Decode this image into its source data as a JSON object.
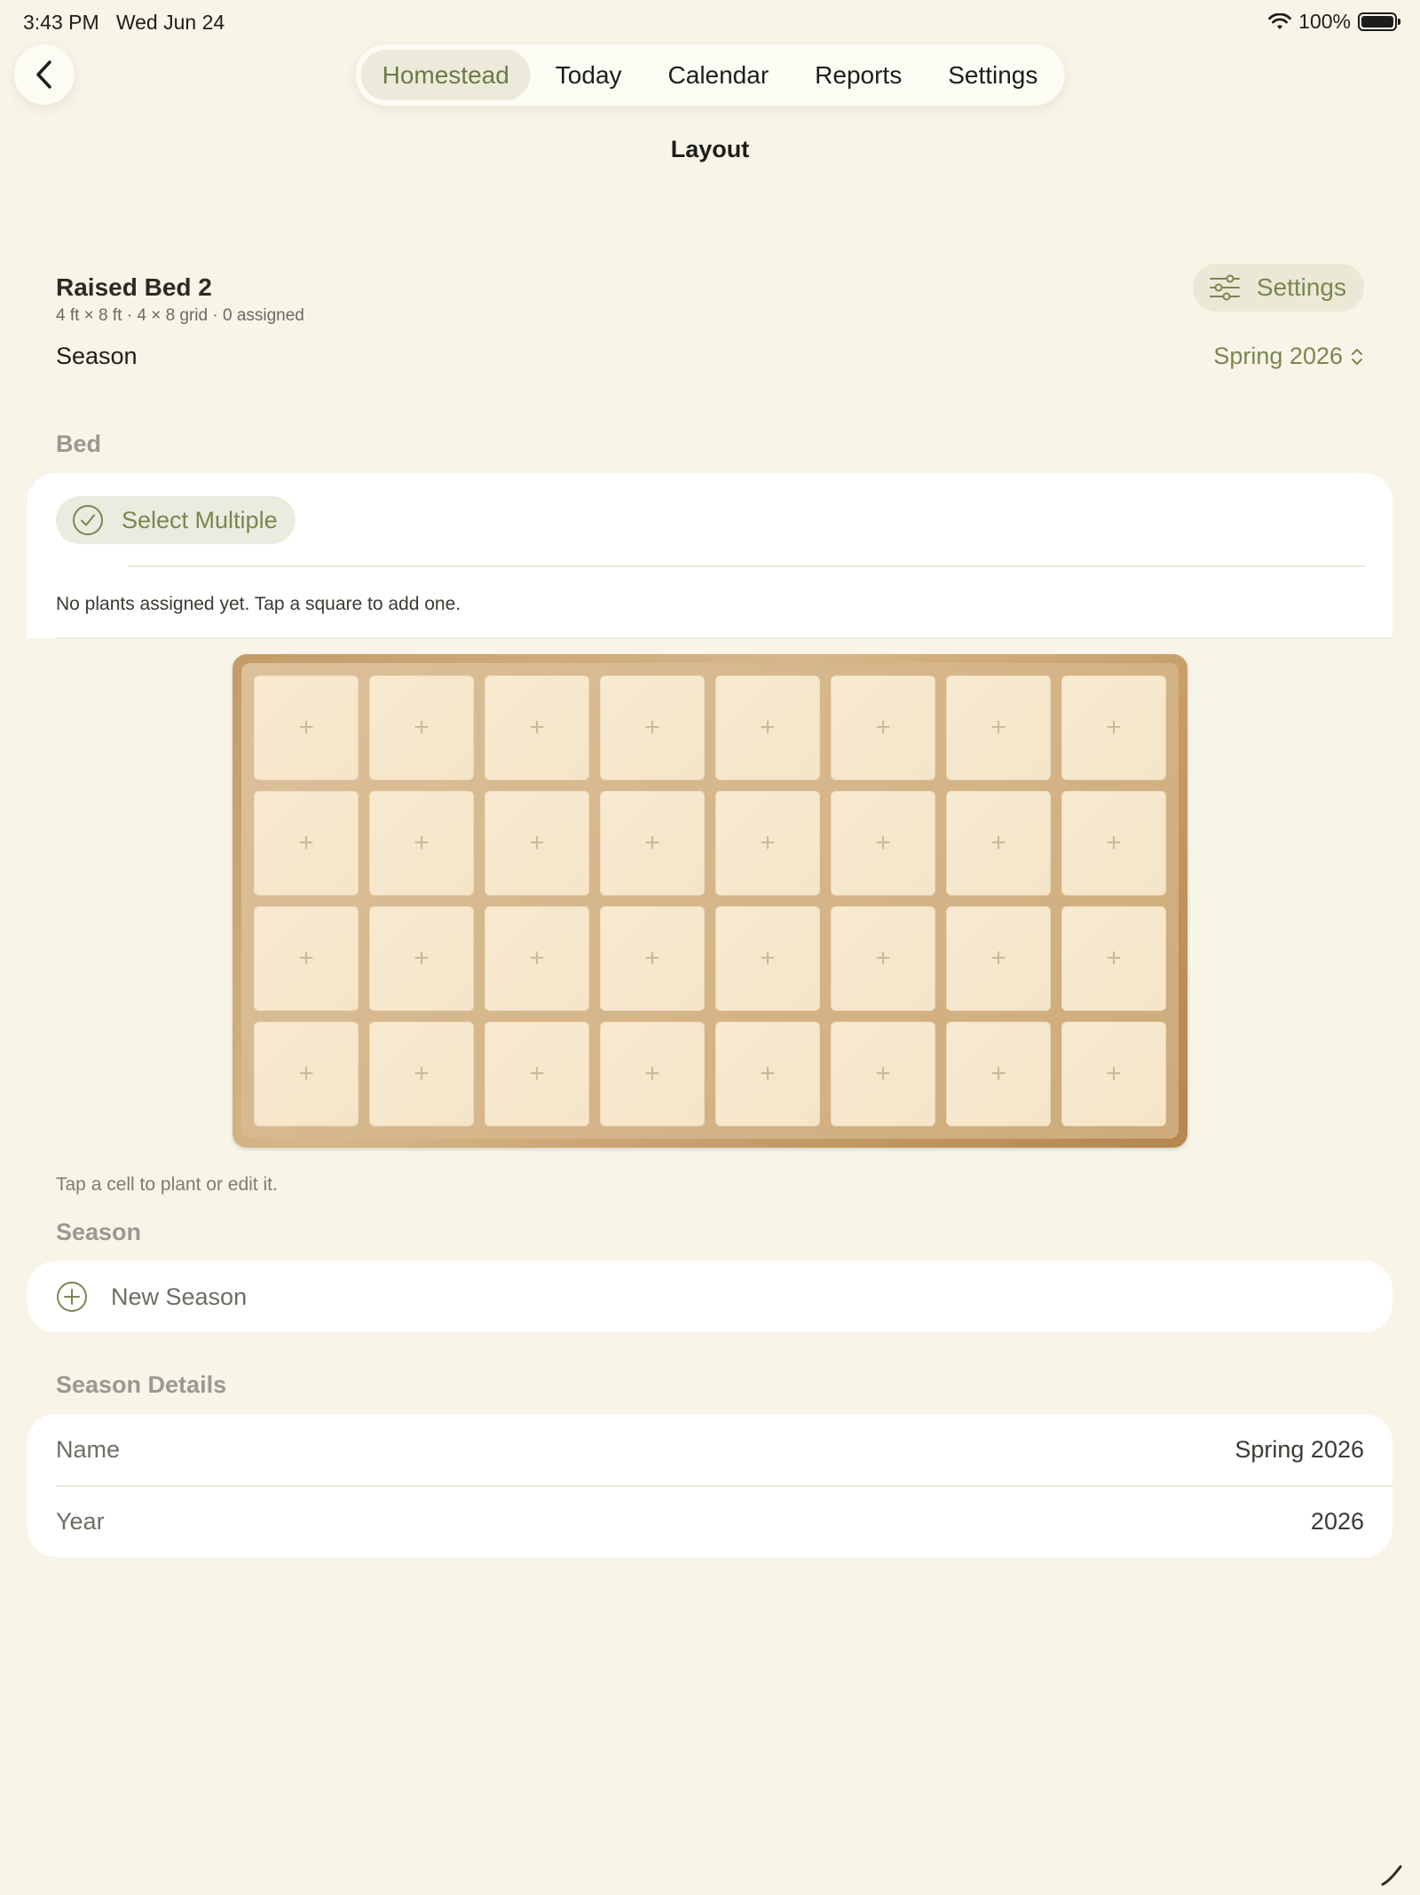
{
  "status": {
    "time": "3:43 PM",
    "date": "Wed Jun 24",
    "battery": "100%"
  },
  "nav": {
    "tabs": [
      {
        "label": "Homestead",
        "active": true
      },
      {
        "label": "Today"
      },
      {
        "label": "Calendar"
      },
      {
        "label": "Reports"
      },
      {
        "label": "Settings"
      }
    ]
  },
  "page": {
    "title": "Layout"
  },
  "bed": {
    "name": "Raised Bed 2",
    "subtitle": "4 ft × 8 ft · 4 × 8 grid · 0 assigned",
    "settings_label": "Settings",
    "season_label": "Season",
    "season_value": "Spring 2026",
    "rows": 4,
    "cols": 8
  },
  "bed_section": {
    "header": "Bed",
    "select_multiple": "Select Multiple",
    "empty_message": "No plants assigned yet. Tap a square to add one.",
    "cell_symbol": "+",
    "hint": "Tap a cell to plant or edit it."
  },
  "season_section": {
    "header": "Season",
    "new_season": "New Season"
  },
  "details": {
    "header": "Season Details",
    "name_label": "Name",
    "name_value": "Spring 2026",
    "year_label": "Year",
    "year_value": "2026"
  },
  "colors": {
    "accent": "#7a8750",
    "background": "#f8f5e8",
    "bed_wood": "#c59c68"
  },
  "icons": {
    "back": "chevron-left-icon",
    "settings": "sliders-icon",
    "select": "checkmark-circle-icon",
    "add": "plus-circle-icon",
    "season_picker": "chevron-up-down-icon"
  }
}
